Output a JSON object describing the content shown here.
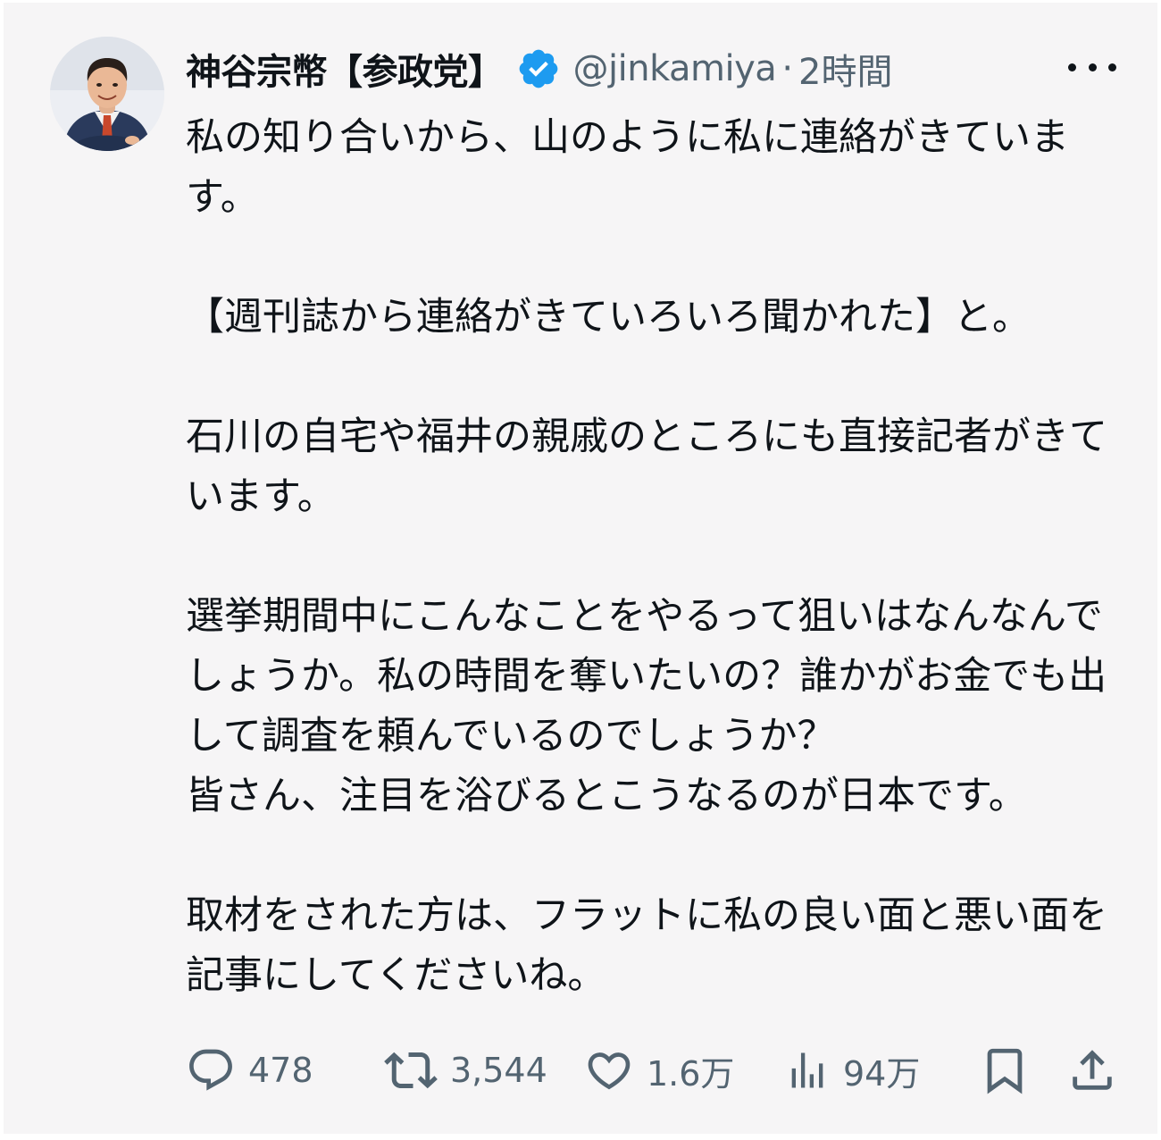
{
  "tweet": {
    "display_name": "神谷宗幣【参政党】",
    "handle": "@jinkamiya",
    "separator": "·",
    "time": "2時間",
    "verified": true,
    "paragraphs": [
      "私の知り合いから、山のように私に連絡がきています。",
      "【週刊誌から連絡がきていろいろ聞かれた】と。",
      "石川の自宅や福井の親戚のところにも直接記者がきています。",
      "選挙期間中にこんなことをやるって狙いはなんなんでしょうか。私の時間を奪いたいの？誰かがお金でも出して調査を頼んでいるのでしょうか？\n皆さん、注目を浴びるとこうなるのが日本です。",
      "取材をされた方は、フラットに私の良い面と悪い面を記事にしてくださいね。"
    ]
  },
  "actions": {
    "replies": "478",
    "retweets": "3,544",
    "likes": "1.6万",
    "views": "94万"
  },
  "icons": {
    "verified": "verified-badge-icon",
    "more": "more-icon",
    "reply": "reply-icon",
    "retweet": "retweet-icon",
    "like": "heart-icon",
    "views": "views-icon",
    "bookmark": "bookmark-icon",
    "share": "share-icon"
  },
  "colors": {
    "background": "#f6f5f6",
    "text": "#0f1419",
    "secondary": "#536471",
    "verified": "#1d9bf0"
  }
}
